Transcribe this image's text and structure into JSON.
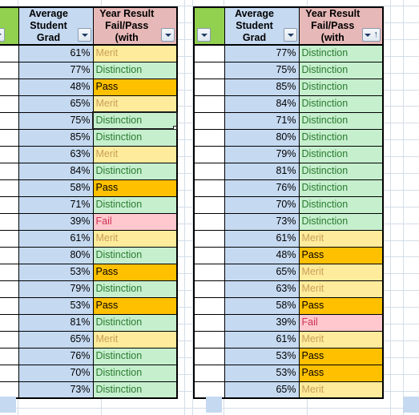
{
  "app": {
    "type": "spreadsheet",
    "description": "Excel worksheet showing two filtered tables of student grades"
  },
  "colors": {
    "header_flag": "#92d050",
    "header_grade": "#c5d9f1",
    "header_result": "#e6b8b7",
    "distinction_bg": "#c6efce",
    "distinction_text": "#2a7b2f",
    "merit_bg": "#ffeb9c",
    "merit_text": "#c8a05a",
    "pass_bg": "#ffc000",
    "pass_text": "#000000",
    "fail_bg": "#ffc7ce",
    "fail_text": "#cc3355",
    "gridline": "#d4dde8",
    "selection_border": "#1b1b1b"
  },
  "icons": {
    "filter_dropdown": "filter-dropdown-icon",
    "sort_ascending": "sort-ascending-icon"
  },
  "tables": [
    {
      "id": "left",
      "headers": {
        "flag": "",
        "grade": "Average Student Grad",
        "result": "Year Result Fail/Pass (with"
      },
      "filters": {
        "flag_active": false,
        "grade_active": false,
        "result_active": false,
        "result_sort": "none",
        "sort_indicator": ""
      },
      "selected_row_index": 4,
      "rows": [
        {
          "grade": "61%",
          "result": "Merit"
        },
        {
          "grade": "77%",
          "result": "Distinction"
        },
        {
          "grade": "48%",
          "result": "Pass"
        },
        {
          "grade": "65%",
          "result": "Merit"
        },
        {
          "grade": "75%",
          "result": "Distinction"
        },
        {
          "grade": "85%",
          "result": "Distinction"
        },
        {
          "grade": "63%",
          "result": "Merit"
        },
        {
          "grade": "84%",
          "result": "Distinction"
        },
        {
          "grade": "58%",
          "result": "Pass"
        },
        {
          "grade": "71%",
          "result": "Distinction"
        },
        {
          "grade": "39%",
          "result": "Fail"
        },
        {
          "grade": "61%",
          "result": "Merit"
        },
        {
          "grade": "80%",
          "result": "Distinction"
        },
        {
          "grade": "53%",
          "result": "Pass"
        },
        {
          "grade": "79%",
          "result": "Distinction"
        },
        {
          "grade": "53%",
          "result": "Pass"
        },
        {
          "grade": "81%",
          "result": "Distinction"
        },
        {
          "grade": "65%",
          "result": "Merit"
        },
        {
          "grade": "76%",
          "result": "Distinction"
        },
        {
          "grade": "70%",
          "result": "Distinction"
        },
        {
          "grade": "73%",
          "result": "Distinction"
        }
      ]
    },
    {
      "id": "right",
      "headers": {
        "flag": "",
        "grade": "Average Student Grad",
        "result": "Year Result Fail/Pass (with"
      },
      "filters": {
        "flag_active": false,
        "grade_active": false,
        "result_active": true,
        "result_sort": "ascending",
        "sort_indicator": "↑"
      },
      "selected_row_index": -1,
      "rows": [
        {
          "grade": "77%",
          "result": "Distinction"
        },
        {
          "grade": "75%",
          "result": "Distinction"
        },
        {
          "grade": "85%",
          "result": "Distinction"
        },
        {
          "grade": "84%",
          "result": "Distinction"
        },
        {
          "grade": "71%",
          "result": "Distinction"
        },
        {
          "grade": "80%",
          "result": "Distinction"
        },
        {
          "grade": "79%",
          "result": "Distinction"
        },
        {
          "grade": "81%",
          "result": "Distinction"
        },
        {
          "grade": "76%",
          "result": "Distinction"
        },
        {
          "grade": "70%",
          "result": "Distinction"
        },
        {
          "grade": "73%",
          "result": "Distinction"
        },
        {
          "grade": "61%",
          "result": "Merit"
        },
        {
          "grade": "48%",
          "result": "Pass"
        },
        {
          "grade": "65%",
          "result": "Merit"
        },
        {
          "grade": "63%",
          "result": "Merit"
        },
        {
          "grade": "58%",
          "result": "Pass"
        },
        {
          "grade": "39%",
          "result": "Fail"
        },
        {
          "grade": "61%",
          "result": "Merit"
        },
        {
          "grade": "53%",
          "result": "Pass"
        },
        {
          "grade": "53%",
          "result": "Pass"
        },
        {
          "grade": "65%",
          "result": "Merit"
        }
      ]
    }
  ]
}
